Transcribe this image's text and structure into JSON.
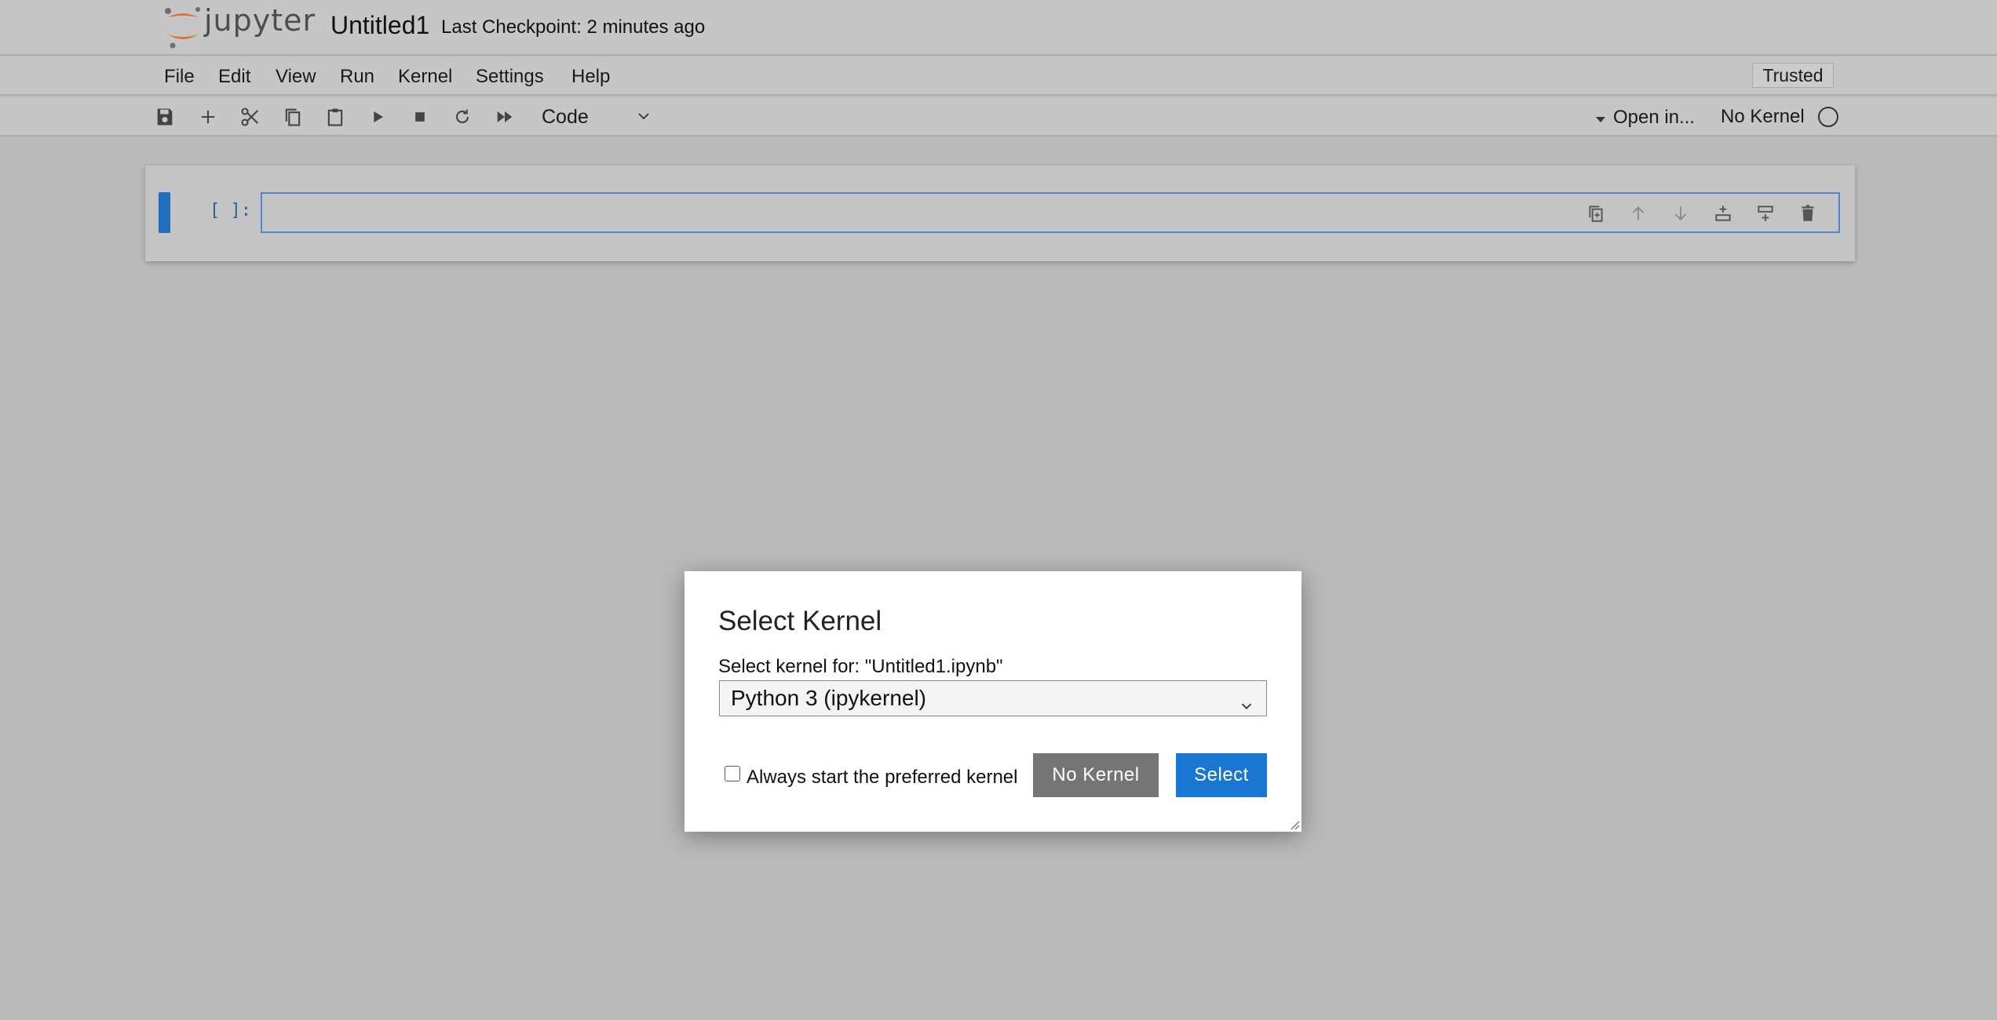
{
  "header": {
    "logo_text": "jupyter",
    "notebook_title": "Untitled1",
    "checkpoint": "Last Checkpoint: 2 minutes ago"
  },
  "menu": {
    "items": [
      {
        "label": "File"
      },
      {
        "label": "Edit"
      },
      {
        "label": "View"
      },
      {
        "label": "Run"
      },
      {
        "label": "Kernel"
      },
      {
        "label": "Settings"
      },
      {
        "label": "Help"
      }
    ],
    "trusted_label": "Trusted"
  },
  "toolbar": {
    "icons": [
      "save-icon",
      "add-cell-icon",
      "cut-icon",
      "copy-icon",
      "paste-icon",
      "run-icon",
      "stop-icon",
      "restart-icon",
      "fast-forward-icon"
    ],
    "cell_type": "Code",
    "open_in_label": "Open in...",
    "kernel_status": "No Kernel"
  },
  "cell": {
    "prompt": "[ ]:",
    "tools": [
      "duplicate-icon",
      "move-up-icon",
      "move-down-icon",
      "insert-above-icon",
      "insert-below-icon",
      "delete-icon"
    ]
  },
  "dialog": {
    "title": "Select Kernel",
    "label": "Select kernel for: \"Untitled1.ipynb\"",
    "selected_kernel": "Python 3 (ipykernel)",
    "checkbox_label": "Always start the preferred kernel",
    "checkbox_checked": false,
    "no_kernel_button": "No Kernel",
    "select_button": "Select"
  },
  "colors": {
    "accent": "#1976d2",
    "logo_orange": "#e46e2e",
    "cell_collapser": "#1f6fbd",
    "secondary_button": "#757575"
  }
}
